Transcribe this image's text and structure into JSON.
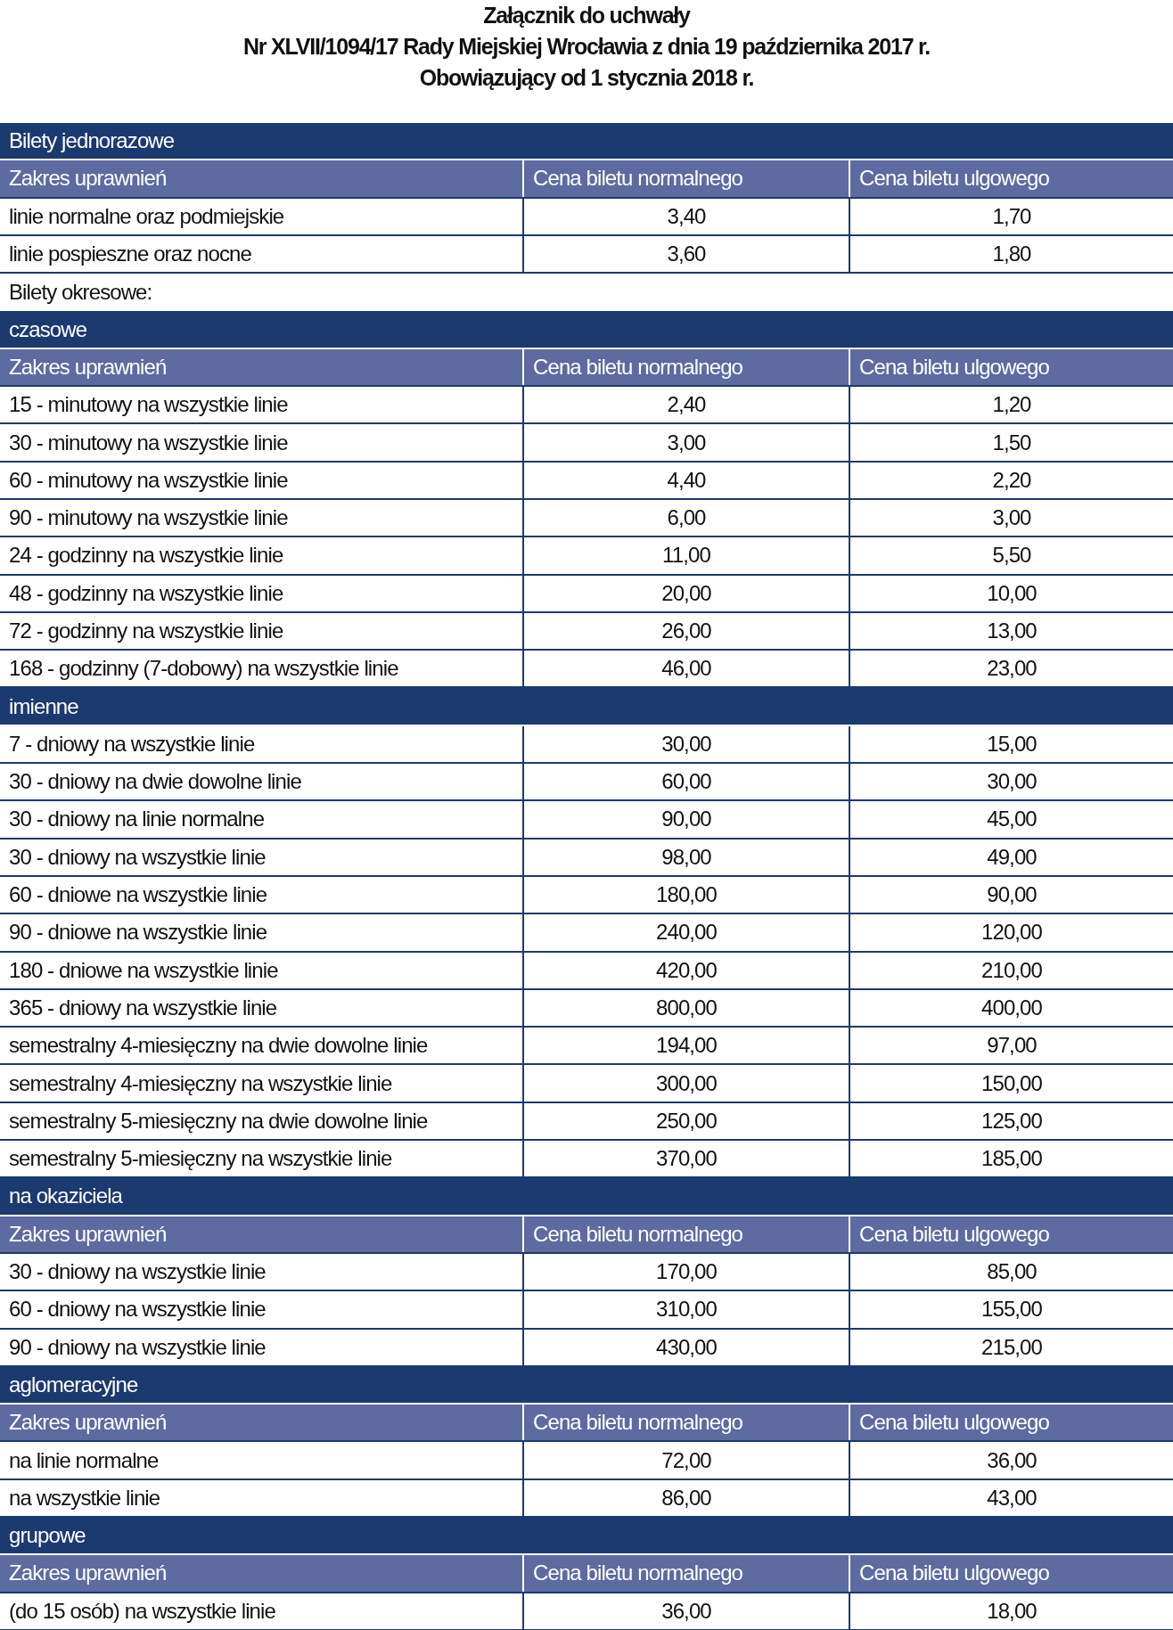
{
  "title_lines": [
    "Załącznik do uchwały",
    "Nr XLVII/1094/17 Rady Miejskiej Wrocławia z dnia 19 października 2017 r.",
    "Obowiązujący od 1 stycznia 2018 r."
  ],
  "rows": [
    {
      "kind": "section",
      "label": "Bilety jednorazowe"
    },
    {
      "kind": "columns",
      "cells": [
        "Zakres uprawnień",
        "Cena biletu normalnego",
        "Cena biletu ulgowego"
      ]
    },
    {
      "kind": "price",
      "cells": [
        "linie normalne oraz podmiejskie",
        "3,40",
        "1,70"
      ]
    },
    {
      "kind": "price",
      "cells": [
        "linie pospieszne oraz nocne",
        "3,60",
        "1,80"
      ]
    },
    {
      "kind": "note",
      "label": "Bilety okresowe:"
    },
    {
      "kind": "section",
      "label": "czasowe"
    },
    {
      "kind": "columns",
      "cells": [
        "Zakres uprawnień",
        "Cena biletu normalnego",
        "Cena biletu ulgowego"
      ]
    },
    {
      "kind": "price",
      "cells": [
        "15 - minutowy na wszystkie linie",
        "2,40",
        "1,20"
      ]
    },
    {
      "kind": "price",
      "cells": [
        "30 - minutowy na wszystkie linie",
        "3,00",
        "1,50"
      ]
    },
    {
      "kind": "price",
      "cells": [
        "60 - minutowy na wszystkie linie",
        "4,40",
        "2,20"
      ]
    },
    {
      "kind": "price",
      "cells": [
        "90 - minutowy na wszystkie linie",
        "6,00",
        "3,00"
      ]
    },
    {
      "kind": "price",
      "cells": [
        "24 - godzinny na wszystkie linie",
        "11,00",
        "5,50"
      ]
    },
    {
      "kind": "price",
      "cells": [
        "48 - godzinny na wszystkie linie",
        "20,00",
        "10,00"
      ]
    },
    {
      "kind": "price",
      "cells": [
        "72 - godzinny na wszystkie linie",
        "26,00",
        "13,00"
      ]
    },
    {
      "kind": "price",
      "cells": [
        "168 - godzinny (7-dobowy) na wszystkie linie",
        "46,00",
        "23,00"
      ]
    },
    {
      "kind": "section",
      "label": "imienne"
    },
    {
      "kind": "price",
      "cells": [
        "7 - dniowy na wszystkie linie",
        "30,00",
        "15,00"
      ]
    },
    {
      "kind": "price",
      "cells": [
        "30 - dniowy na dwie dowolne linie",
        "60,00",
        "30,00"
      ]
    },
    {
      "kind": "price",
      "cells": [
        "30 - dniowy na linie normalne",
        "90,00",
        "45,00"
      ]
    },
    {
      "kind": "price",
      "cells": [
        "30 - dniowy na wszystkie linie",
        "98,00",
        "49,00"
      ]
    },
    {
      "kind": "price",
      "cells": [
        "60 - dniowe na wszystkie linie",
        "180,00",
        "90,00"
      ]
    },
    {
      "kind": "price",
      "cells": [
        "90 - dniowe na wszystkie linie",
        "240,00",
        "120,00"
      ]
    },
    {
      "kind": "price",
      "cells": [
        "180 - dniowe na wszystkie linie",
        "420,00",
        "210,00"
      ]
    },
    {
      "kind": "price",
      "cells": [
        "365 - dniowy na wszystkie linie",
        "800,00",
        "400,00"
      ]
    },
    {
      "kind": "price",
      "cells": [
        "semestralny 4-miesięczny na dwie dowolne linie",
        "194,00",
        "97,00"
      ]
    },
    {
      "kind": "price",
      "cells": [
        "semestralny 4-miesięczny na wszystkie linie",
        "300,00",
        "150,00"
      ]
    },
    {
      "kind": "price",
      "cells": [
        "semestralny 5-miesięczny na dwie dowolne linie",
        "250,00",
        "125,00"
      ]
    },
    {
      "kind": "price",
      "cells": [
        "semestralny 5-miesięczny na wszystkie linie",
        "370,00",
        "185,00"
      ]
    },
    {
      "kind": "section",
      "label": "na okaziciela"
    },
    {
      "kind": "columns",
      "cells": [
        "Zakres uprawnień",
        "Cena biletu normalnego",
        "Cena biletu ulgowego"
      ]
    },
    {
      "kind": "price",
      "cells": [
        "30 - dniowy na wszystkie linie",
        "170,00",
        "85,00"
      ]
    },
    {
      "kind": "price",
      "cells": [
        "60 - dniowy na wszystkie linie",
        "310,00",
        "155,00"
      ]
    },
    {
      "kind": "price",
      "cells": [
        "90 - dniowy na wszystkie linie",
        "430,00",
        "215,00"
      ]
    },
    {
      "kind": "section",
      "label": "aglomeracyjne"
    },
    {
      "kind": "columns",
      "cells": [
        "Zakres uprawnień",
        "Cena biletu normalnego",
        "Cena biletu ulgowego"
      ]
    },
    {
      "kind": "price",
      "cells": [
        "na linie normalne",
        "72,00",
        "36,00"
      ]
    },
    {
      "kind": "price",
      "cells": [
        "na wszystkie linie",
        "86,00",
        "43,00"
      ]
    },
    {
      "kind": "section",
      "label": "grupowe"
    },
    {
      "kind": "columns",
      "cells": [
        "Zakres uprawnień",
        "Cena biletu normalnego",
        "Cena biletu ulgowego"
      ]
    },
    {
      "kind": "price",
      "cells": [
        "(do 15 osób) na wszystkie linie",
        "36,00",
        "18,00"
      ]
    }
  ]
}
